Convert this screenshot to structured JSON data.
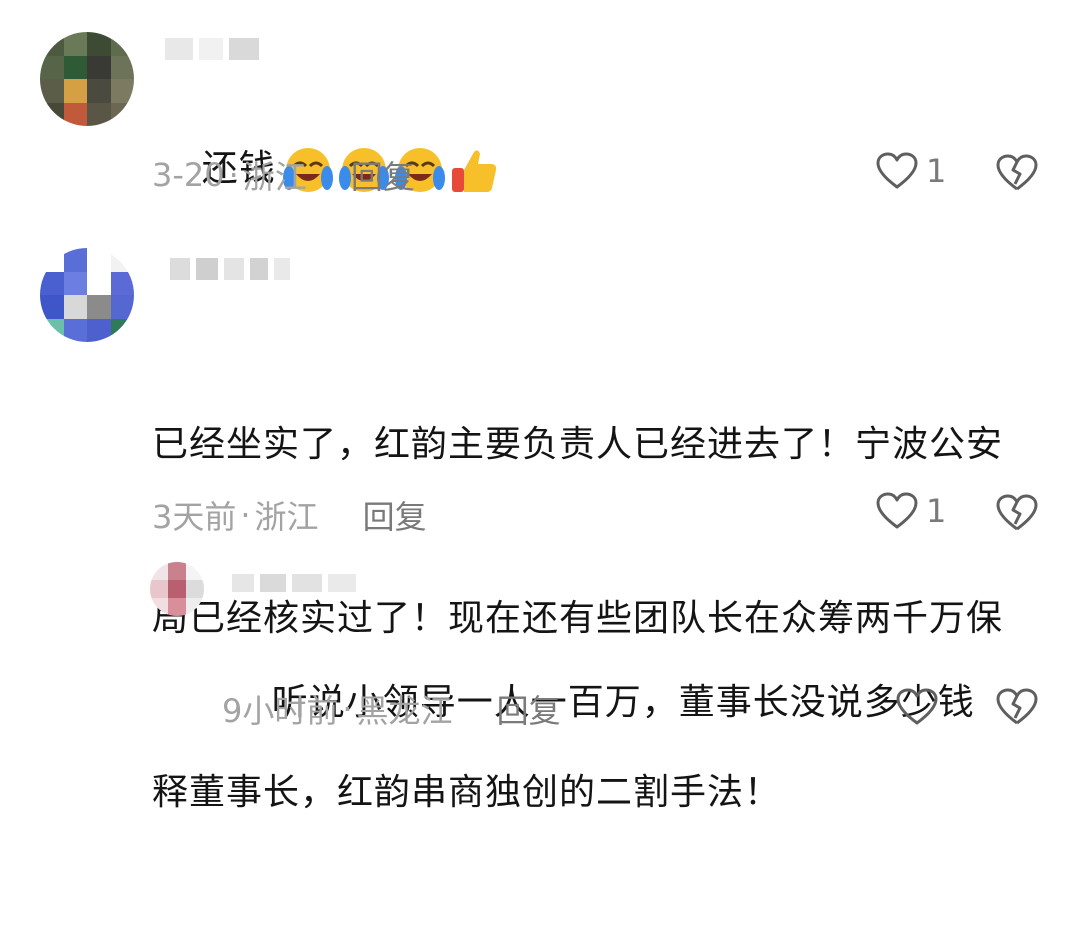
{
  "comments": [
    {
      "text": "还钱",
      "emojis": [
        "laughing-crying-icon",
        "laughing-crying-icon",
        "laughing-crying-icon",
        "thumbs-up-icon"
      ],
      "time": "3-20",
      "sep": "·",
      "location": "浙江",
      "reply_label": "回复",
      "likes": "1"
    },
    {
      "text": "已经坐实了，红韵主要负责人已经进去了！宁波公安局已经核实过了！现在还有些团队长在众筹两千万保释董事长，红韵串商独创的二割手法！",
      "line1": "已经坐实了，红韵主要负责人已经进去了！宁波公安",
      "line2": "局已经核实过了！现在还有些团队长在众筹两千万保",
      "line3": "释董事长，红韵串商独创的二割手法！",
      "time": "3天前",
      "sep": "·",
      "location": "浙江",
      "reply_label": "回复",
      "likes": "1"
    },
    {
      "text": "听说小领导一人一百万，董事长没说多少钱",
      "time": "9小时前",
      "sep": "·",
      "location": "黑龙江",
      "reply_label": "回复",
      "likes": ""
    }
  ],
  "colors": {
    "meta_text": "#a3a3a3",
    "action_text": "#7a7a7a",
    "emoji_yellow": "#f7c02b",
    "tear_blue": "#3a8bea"
  }
}
